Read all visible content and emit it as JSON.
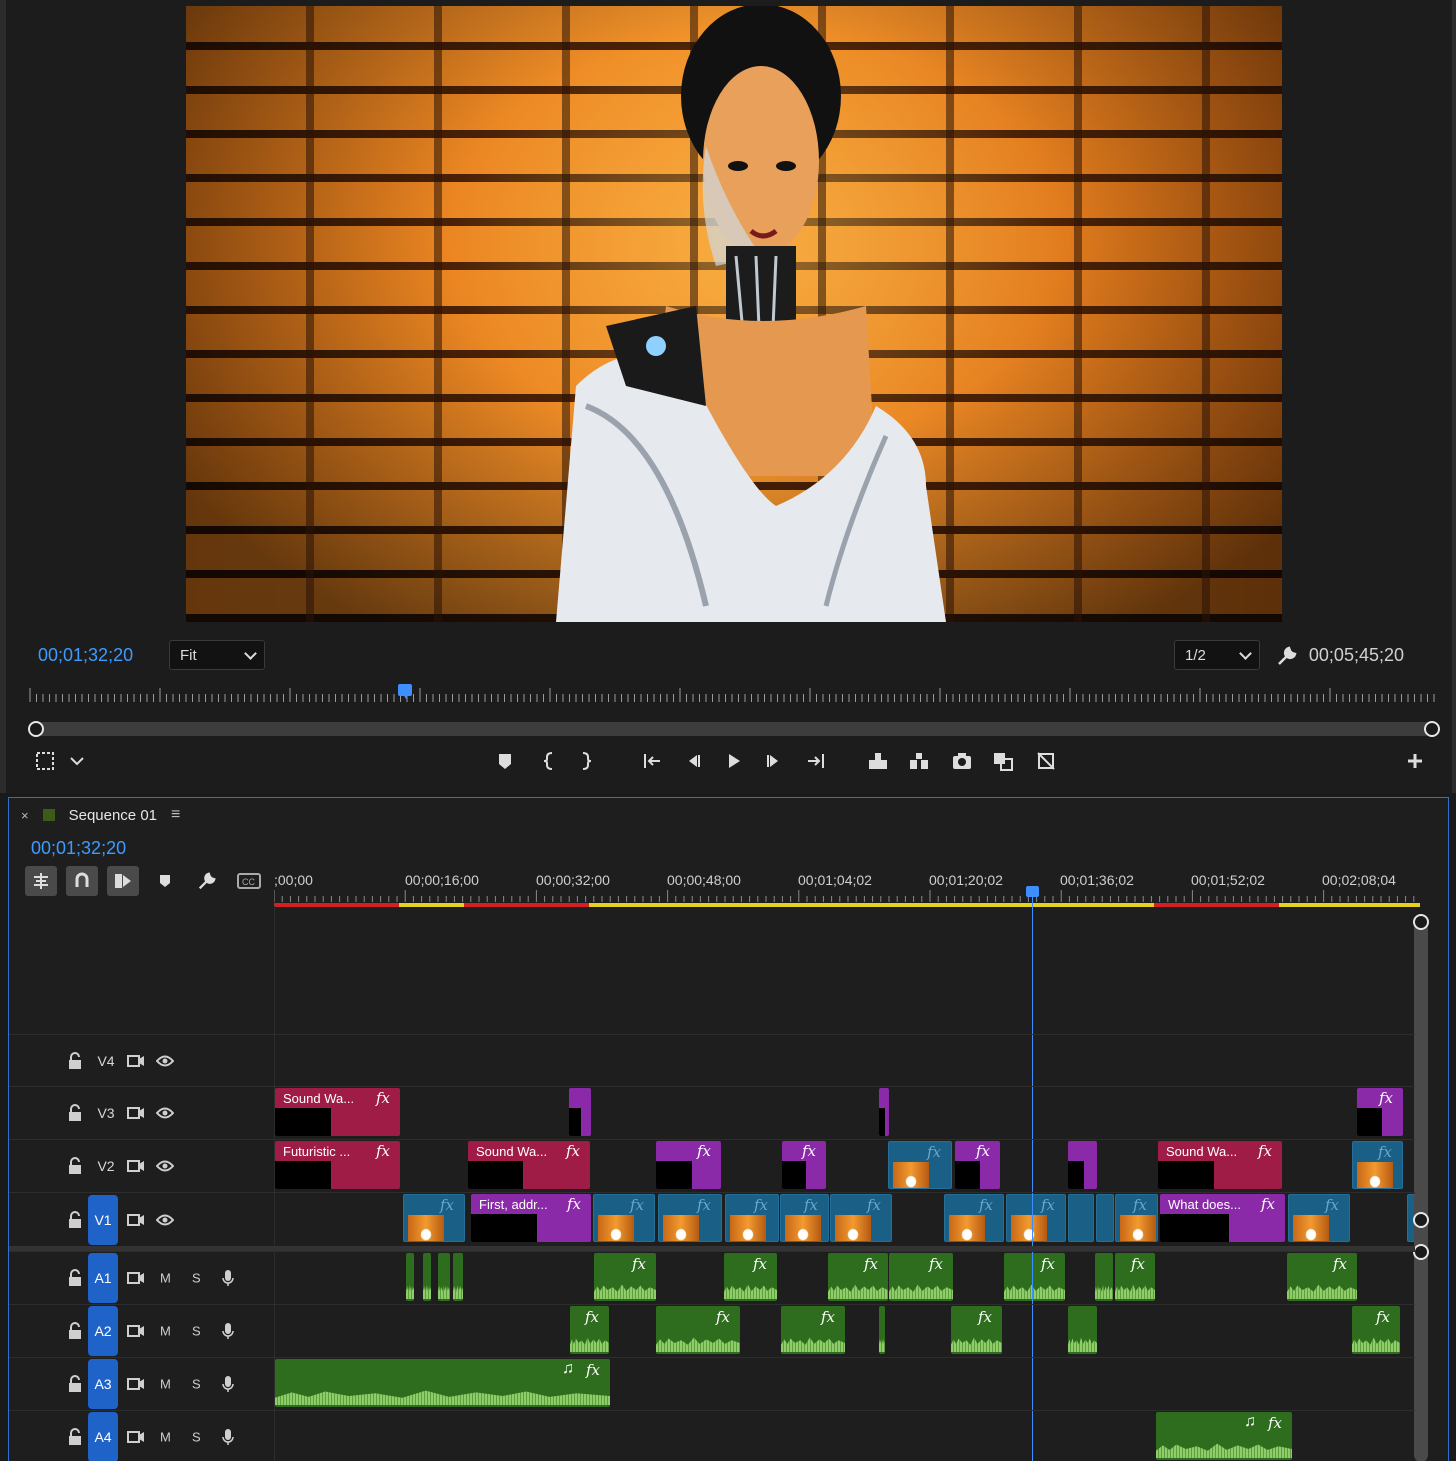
{
  "monitor": {
    "current_timecode": "00;01;32;20",
    "fit_select": "Fit",
    "resolution_select": "1/2",
    "duration_timecode": "00;05;45;20",
    "playhead_fraction": 0.268
  },
  "timeline": {
    "sequence_name": "Sequence 01",
    "current_timecode": "00;01;32;20",
    "ruler_labels": [
      ";00;00",
      "00;00;16;00",
      "00;00;32;00",
      "00;00;48;00",
      "00;01;04;02",
      "00;01;20;02",
      "00;01;36;02",
      "00;01;52;02",
      "00;02;08;04"
    ],
    "video_tracks": [
      "V4",
      "V3",
      "V2",
      "V1"
    ],
    "audio_tracks": [
      "A1",
      "A2",
      "A3",
      "A4"
    ],
    "mute_label": "M",
    "solo_label": "S",
    "fx_label": "fx",
    "music_note": "♫",
    "clip_labels": {
      "v3_1": "Sound Wa...",
      "v2_1": "Futuristic ...",
      "v2_2": "Sound Wa...",
      "v2_3": "Sound Wa...",
      "v1_1": "First, addr...",
      "v1_2": "What does..."
    },
    "colors": {
      "accent": "#3d9bff",
      "graphic_clip": "#9e1c46",
      "title_clip": "#8a2aa8",
      "video_clip": "#1a5f86",
      "audio_clip": "#2d6d1d"
    }
  },
  "icons": [
    "wrench-icon",
    "marker-icon",
    "mark-in-icon",
    "mark-out-icon",
    "go-to-in-icon",
    "step-back-icon",
    "play-icon",
    "step-forward-icon",
    "go-to-out-icon",
    "lift-icon",
    "extract-icon",
    "camera-icon",
    "comparison-icon",
    "proxy-icon",
    "add-icon",
    "lock-icon",
    "eye-icon",
    "mic-icon",
    "film-target-icon",
    "captions-icon",
    "snap-icon",
    "linked-selection-icon"
  ]
}
